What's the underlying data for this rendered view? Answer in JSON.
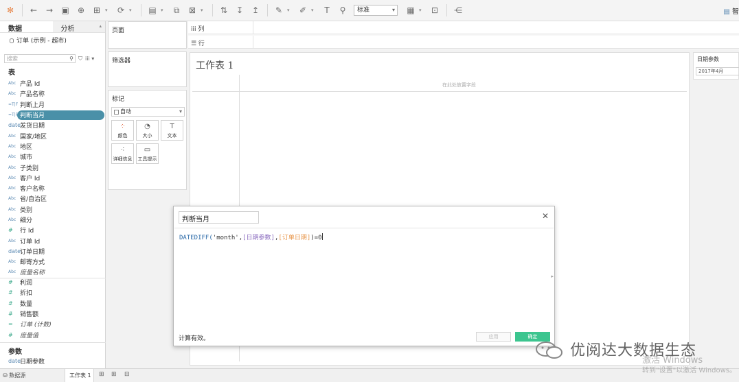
{
  "toolbar": {
    "view_size": "标准",
    "right_label": "智"
  },
  "left_pane": {
    "tabs": {
      "data": "数据",
      "analysis": "分析"
    },
    "datasource": "订单 (示例 - 超市)",
    "search_placeholder": "搜索",
    "tables_header": "表",
    "dimensions": [
      {
        "type": "Abc",
        "label": "产品 Id"
      },
      {
        "type": "Abc",
        "label": "产品名称"
      },
      {
        "type": "=T|F",
        "label": "判断上月"
      },
      {
        "type": "=T|F",
        "label": "判断当月"
      },
      {
        "type": "date",
        "label": "发货日期"
      },
      {
        "type": "Abc",
        "label": "国家/地区"
      },
      {
        "type": "Abc",
        "label": "地区"
      },
      {
        "type": "Abc",
        "label": "城市"
      },
      {
        "type": "Abc",
        "label": "子类别"
      },
      {
        "type": "Abc",
        "label": "客户 Id"
      },
      {
        "type": "Abc",
        "label": "客户名称"
      },
      {
        "type": "Abc",
        "label": "省/自治区"
      },
      {
        "type": "Abc",
        "label": "类别"
      },
      {
        "type": "Abc",
        "label": "细分"
      },
      {
        "type": "#",
        "label": "行 Id"
      },
      {
        "type": "Abc",
        "label": "订单 Id"
      },
      {
        "type": "date",
        "label": "订单日期"
      },
      {
        "type": "Abc",
        "label": "邮寄方式"
      },
      {
        "type": "Abc",
        "label": "度量名称"
      }
    ],
    "measures": [
      {
        "type": "#",
        "label": "利润"
      },
      {
        "type": "#",
        "label": "折扣"
      },
      {
        "type": "#",
        "label": "数量"
      },
      {
        "type": "#",
        "label": "销售额"
      },
      {
        "type": "=",
        "label": "订单 (计数)"
      },
      {
        "type": "#",
        "label": "度量值"
      }
    ],
    "params_header": "参数",
    "params": [
      {
        "type": "date",
        "label": "日期参数"
      }
    ]
  },
  "cards": {
    "pages": "页面",
    "filters": "筛选器",
    "marks": "标记",
    "marks_type": "自动",
    "mark_buttons": [
      {
        "icon": "color-icon",
        "glyph": "⁘",
        "label": "颜色"
      },
      {
        "icon": "size-icon",
        "glyph": "◔",
        "label": "大小"
      },
      {
        "icon": "text-icon",
        "glyph": "T",
        "label": "文本"
      },
      {
        "icon": "detail-icon",
        "glyph": "⁖",
        "label": "详细信息"
      },
      {
        "icon": "tooltip-icon",
        "glyph": "▭",
        "label": "工具提示"
      }
    ]
  },
  "shelves": {
    "columns": "iii 列",
    "rows": "☰ 行"
  },
  "worksheet": {
    "title": "工作表 1",
    "drop_hint": "在此处放置字段"
  },
  "parameter_card": {
    "title": "日期参数",
    "value": "2017年4月"
  },
  "bottom": {
    "datasource": "数据源",
    "sheet_tab": "工作表 1"
  },
  "calc_dialog": {
    "name": "判断当月",
    "formula": {
      "fn": "DATEDIFF(",
      "str": "'month',",
      "param": "[日期参数]",
      "comma": ",",
      "field": "[订单日期]",
      "tail": ")=0"
    },
    "status": "计算有效。",
    "apply_label": "应用",
    "ok_label": "确定"
  },
  "watermark": {
    "text": "优阅达大数据生态",
    "win_line1": "激活 Windows",
    "win_line2": "转到\"设置\"以激活 Windows。"
  }
}
